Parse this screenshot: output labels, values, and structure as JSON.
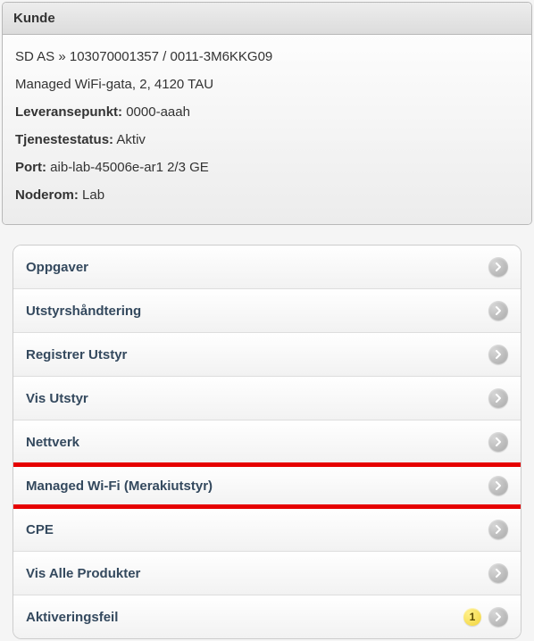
{
  "panel": {
    "title": "Kunde",
    "breadcrumb": "SD AS » 103070001357 / 0011-3M6KKG09",
    "address": "Managed WiFi-gata, 2, 4120 TAU",
    "rows": [
      {
        "label": "Leveransepunkt:",
        "value": "0000-aaah"
      },
      {
        "label": "Tjenestestatus:",
        "value": "Aktiv"
      },
      {
        "label": "Port:",
        "value": "aib-lab-45006e-ar1 2/3 GE"
      },
      {
        "label": "Noderom:",
        "value": "Lab"
      }
    ]
  },
  "menu": [
    {
      "label": "Oppgaver",
      "highlighted": false
    },
    {
      "label": "Utstyrshåndtering",
      "highlighted": false
    },
    {
      "label": "Registrer Utstyr",
      "highlighted": false
    },
    {
      "label": "Vis Utstyr",
      "highlighted": false
    },
    {
      "label": "Nettverk",
      "highlighted": false
    },
    {
      "label": "Managed Wi-Fi (Merakiutstyr)",
      "highlighted": true
    },
    {
      "label": "CPE",
      "highlighted": false
    },
    {
      "label": "Vis Alle Produkter",
      "highlighted": false
    },
    {
      "label": "Aktiveringsfeil",
      "highlighted": false,
      "badge": "1"
    }
  ]
}
